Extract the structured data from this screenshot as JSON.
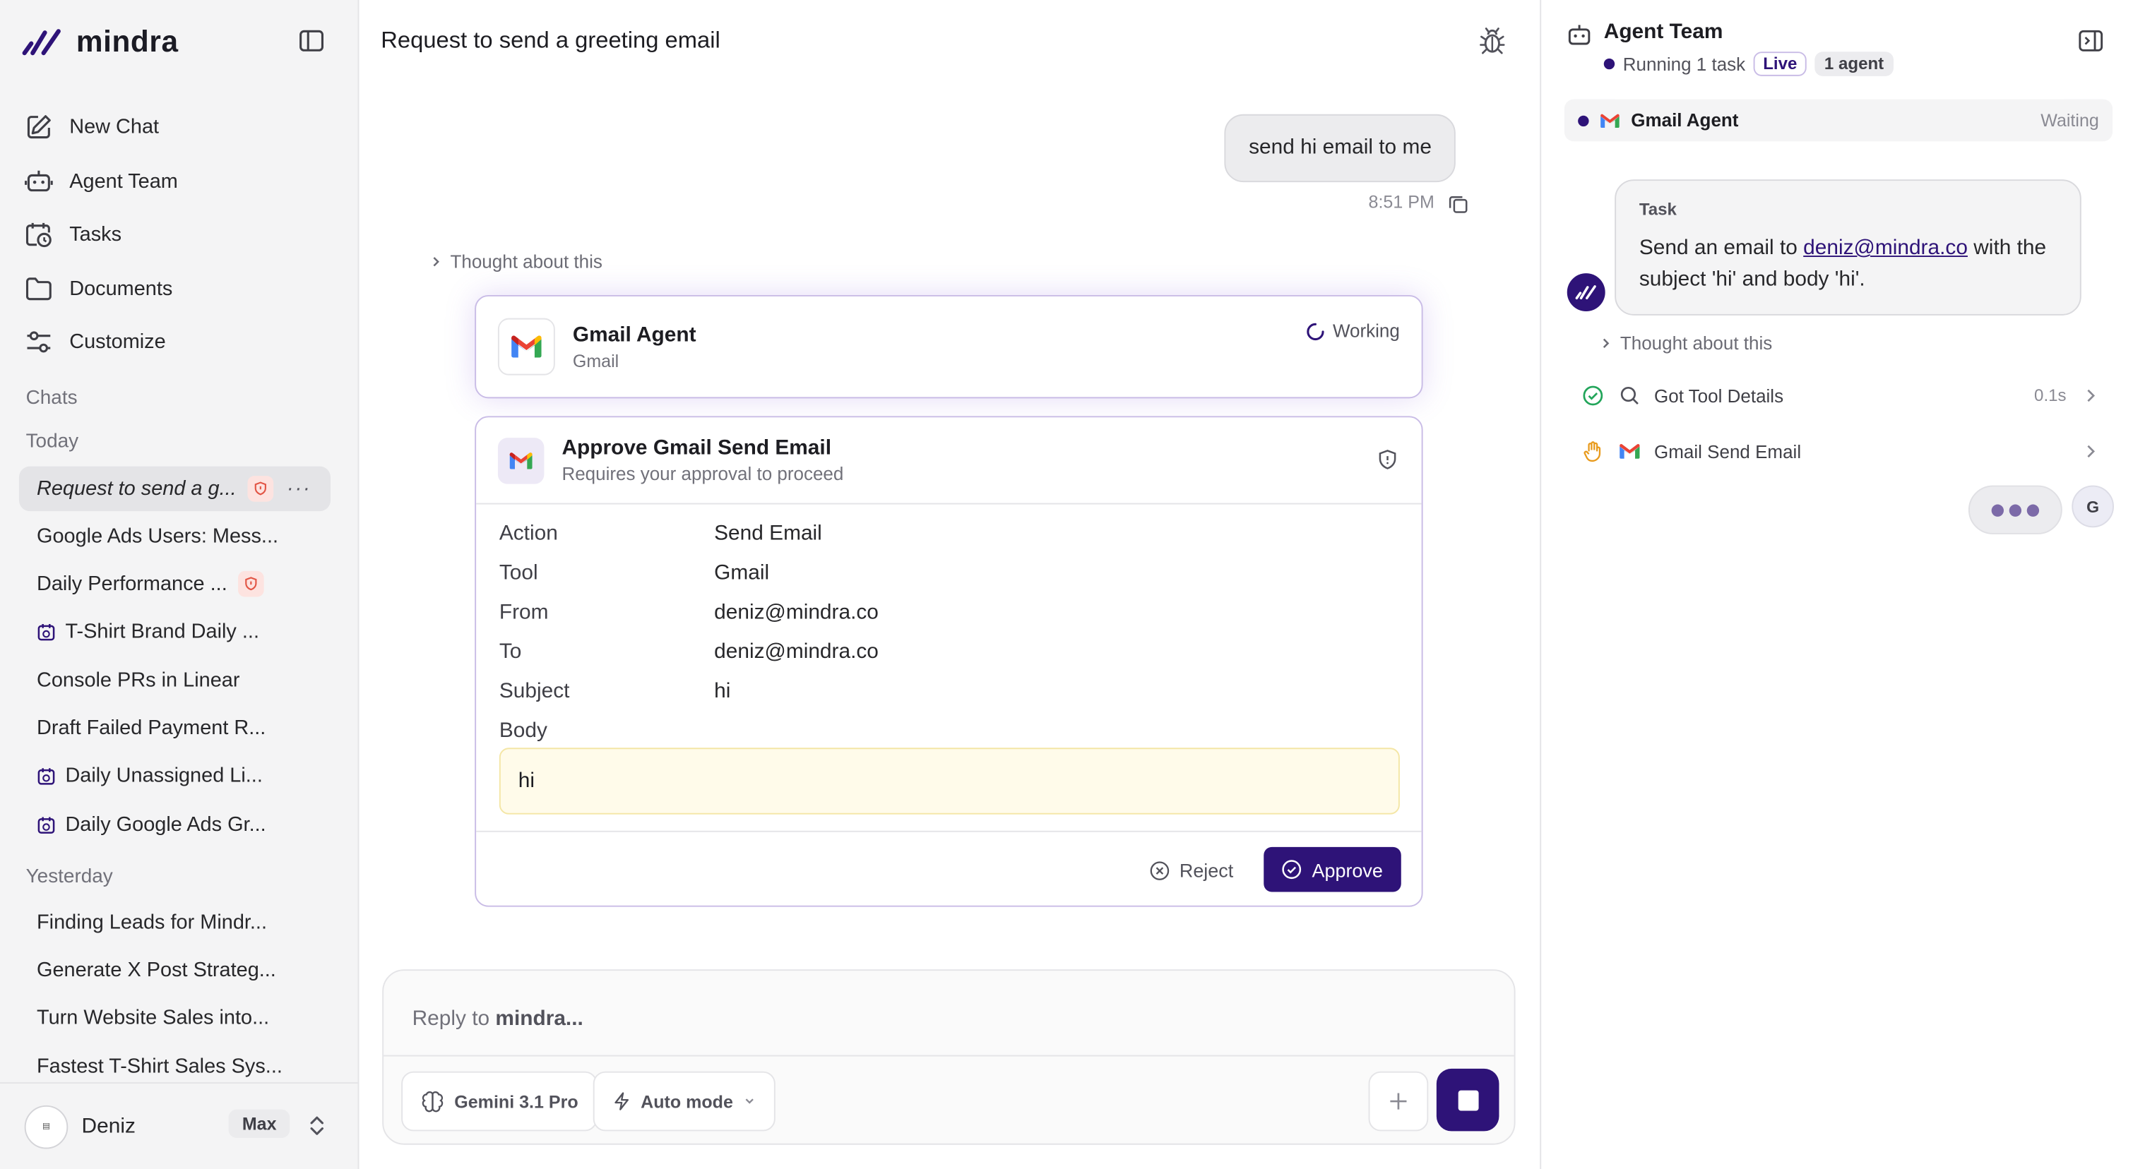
{
  "app": {
    "name": "mindra"
  },
  "colors": {
    "accent": "#2e1378",
    "danger_badge": "#fde3e0",
    "body_highlight": "#fffbea"
  },
  "nav": [
    {
      "label": "New Chat",
      "icon": "edit-icon"
    },
    {
      "label": "Agent Team",
      "icon": "robot-icon"
    },
    {
      "label": "Tasks",
      "icon": "calendar-clock-icon"
    },
    {
      "label": "Documents",
      "icon": "folder-icon"
    },
    {
      "label": "Customize",
      "icon": "sliders-icon"
    }
  ],
  "sidebar": {
    "chats_label": "Chats",
    "today_label": "Today",
    "yesterday_label": "Yesterday",
    "today": [
      {
        "title": "Request to send a g...",
        "active": true,
        "badge": "shield-alert-icon",
        "more": "···"
      },
      {
        "title": "Google Ads Users: Mess..."
      },
      {
        "title": "Daily Performance ...",
        "badge": "shield-alert-icon"
      },
      {
        "title": "T-Shirt Brand Daily ...",
        "icon": "calendar-clock-icon"
      },
      {
        "title": "Console PRs in Linear"
      },
      {
        "title": "Draft Failed Payment R..."
      },
      {
        "title": "Daily Unassigned Li...",
        "icon": "calendar-clock-icon"
      },
      {
        "title": "Daily Google Ads Gr...",
        "icon": "calendar-clock-icon"
      }
    ],
    "yesterday": [
      {
        "title": "Finding Leads for Mindr..."
      },
      {
        "title": "Generate X Post Strateg..."
      },
      {
        "title": "Turn Website Sales into..."
      },
      {
        "title": "Fastest T-Shirt Sales Sys..."
      }
    ],
    "user": {
      "name": "Deniz",
      "plan": "Max"
    }
  },
  "main": {
    "title": "Request to send a greeting email",
    "user_message": "send hi email to me",
    "message_time": "8:51 PM",
    "thought_label": "Thought about this",
    "agent_card": {
      "name": "Gmail Agent",
      "tool": "Gmail",
      "status": "Working"
    },
    "approval": {
      "title": "Approve Gmail Send Email",
      "subtitle": "Requires your approval to proceed",
      "fields": [
        {
          "key": "Action",
          "value": "Send Email"
        },
        {
          "key": "Tool",
          "value": "Gmail"
        },
        {
          "key": "From",
          "value": "deniz@mindra.co"
        },
        {
          "key": "To",
          "value": "deniz@mindra.co"
        },
        {
          "key": "Subject",
          "value": "hi"
        }
      ],
      "body_label": "Body",
      "body": "hi",
      "reject_label": "Reject",
      "approve_label": "Approve"
    },
    "composer": {
      "placeholder_prefix": "Reply to ",
      "placeholder_name": "mindra...",
      "model": "Gemini 3.1 Pro",
      "mode": "Auto mode"
    }
  },
  "agent_panel": {
    "title": "Agent Team",
    "status": "Running 1 task",
    "live_badge": "Live",
    "agents_badge": "1 agent",
    "agent": {
      "name": "Gmail Agent",
      "status": "Waiting"
    },
    "task": {
      "label": "Task",
      "text_before": "Send an email to ",
      "email": "deniz@mindra.co",
      "text_after": " with the subject 'hi' and body 'hi'."
    },
    "thought_label": "Thought about this",
    "steps": [
      {
        "label": "Got Tool Details",
        "time": "0.1s",
        "status": "done"
      },
      {
        "label": "Gmail Send Email",
        "status": "awaiting"
      }
    ],
    "user_initial": "G"
  }
}
